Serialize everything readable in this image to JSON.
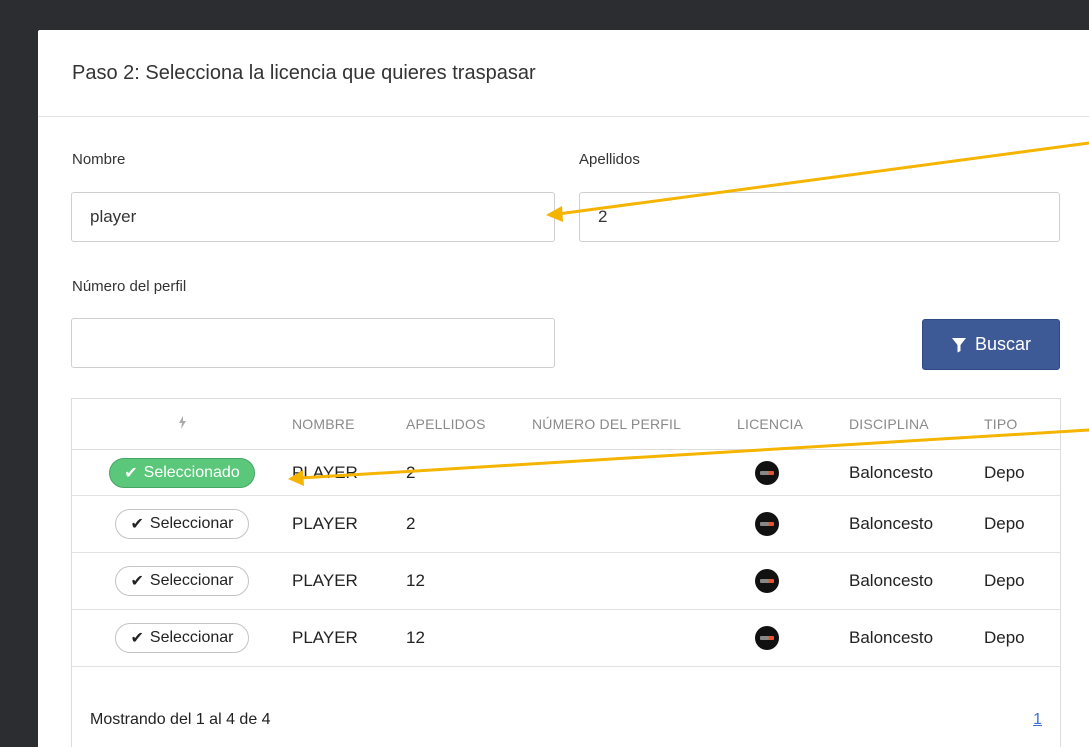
{
  "header": {
    "title": "Paso 2: Selecciona la licencia que quieres traspasar"
  },
  "form": {
    "nombre_label": "Nombre",
    "nombre_value": "player",
    "apellidos_label": "Apellidos",
    "apellidos_value": "2",
    "perfil_label": "Número del perfil",
    "perfil_value": "",
    "buscar_label": "Buscar"
  },
  "table": {
    "columns": [
      "",
      "NOMBRE",
      "APELLIDOS",
      "NÚMERO DEL PERFIL",
      "LICENCIA",
      "DISCIPLINA",
      "TIPO"
    ],
    "action_icon": "bolt-icon",
    "rows": [
      {
        "action": "Seleccionado",
        "selected": true,
        "nombre": "PLAYER",
        "apellidos": "2",
        "numero": "",
        "disciplina": "Baloncesto",
        "tipo": "Depo"
      },
      {
        "action": "Seleccionar",
        "selected": false,
        "nombre": "PLAYER",
        "apellidos": "2",
        "numero": "",
        "disciplina": "Baloncesto",
        "tipo": "Depo"
      },
      {
        "action": "Seleccionar",
        "selected": false,
        "nombre": "PLAYER",
        "apellidos": "12",
        "numero": "",
        "disciplina": "Baloncesto",
        "tipo": "Depo"
      },
      {
        "action": "Seleccionar",
        "selected": false,
        "nombre": "PLAYER",
        "apellidos": "12",
        "numero": "",
        "disciplina": "Baloncesto",
        "tipo": "Depo"
      }
    ]
  },
  "footer": {
    "summary": "Mostrando del 1 al 4 de 4",
    "page": "1"
  },
  "colors": {
    "accent": "#3e5a96",
    "selected": "#5bc77a",
    "annotation_arrow": "#f5b400",
    "background": "#2b2d31"
  }
}
